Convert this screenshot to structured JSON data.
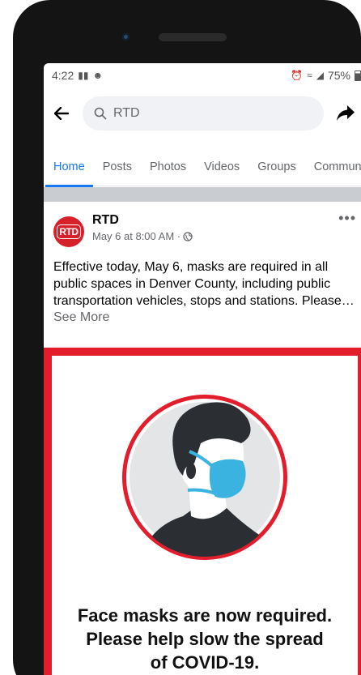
{
  "status": {
    "time": "4:22",
    "battery": "75%"
  },
  "search": {
    "query": "RTD"
  },
  "tabs": [
    "Home",
    "Posts",
    "Photos",
    "Videos",
    "Groups",
    "Community"
  ],
  "post": {
    "author": "RTD",
    "avatar_text": "RTD",
    "time": "May 6 at 8:00 AM ·",
    "text": "Effective today, May 6, masks are required in all public spaces in Denver County, including public transportation vehicles, stops and stations. Please…",
    "see_more": "See More",
    "image": {
      "line1": "Face masks are now required.",
      "line2": "Please help slow the spread",
      "line3": "of COVID-19."
    }
  },
  "colors": {
    "accent": "#1877f2",
    "rtd_red": "#e31e2c",
    "mask_blue": "#3bb3e0"
  }
}
